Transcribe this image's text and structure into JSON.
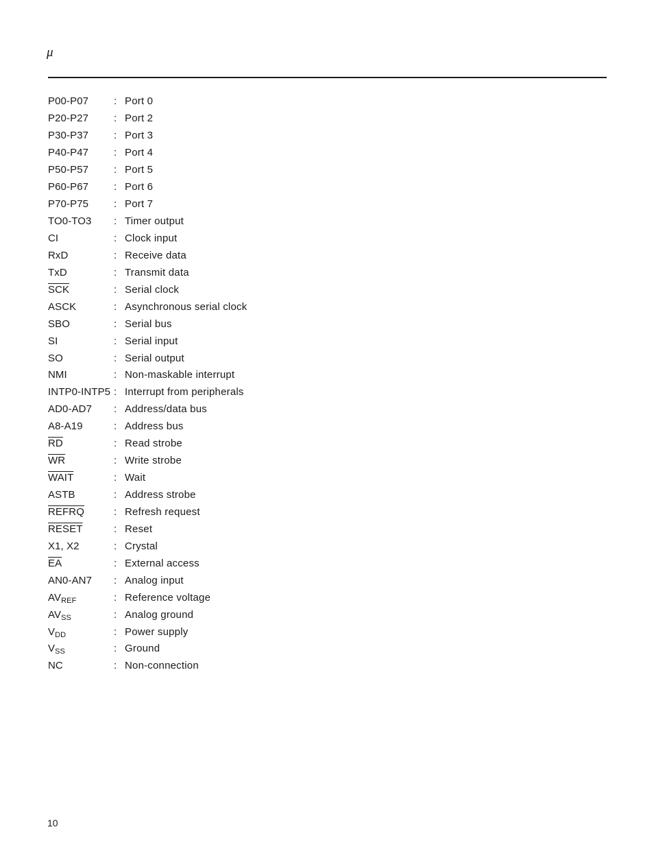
{
  "header": {
    "symbol": "μ"
  },
  "pins": [
    {
      "name": "P00-P07",
      "sub": "",
      "overbar": false,
      "desc": "Port 0"
    },
    {
      "name": "P20-P27",
      "sub": "",
      "overbar": false,
      "desc": "Port 2"
    },
    {
      "name": "P30-P37",
      "sub": "",
      "overbar": false,
      "desc": "Port 3"
    },
    {
      "name": "P40-P47",
      "sub": "",
      "overbar": false,
      "desc": "Port 4"
    },
    {
      "name": "P50-P57",
      "sub": "",
      "overbar": false,
      "desc": "Port 5"
    },
    {
      "name": "P60-P67",
      "sub": "",
      "overbar": false,
      "desc": "Port 6"
    },
    {
      "name": "P70-P75",
      "sub": "",
      "overbar": false,
      "desc": "Port 7"
    },
    {
      "name": "TO0-TO3",
      "sub": "",
      "overbar": false,
      "desc": "Timer output"
    },
    {
      "name": "CI",
      "sub": "",
      "overbar": false,
      "desc": "Clock input"
    },
    {
      "name": "RxD",
      "sub": "",
      "overbar": false,
      "desc": "Receive data"
    },
    {
      "name": "TxD",
      "sub": "",
      "overbar": false,
      "desc": "Transmit data"
    },
    {
      "name": "SCK",
      "sub": "",
      "overbar": true,
      "desc": "Serial clock"
    },
    {
      "name": "ASCK",
      "sub": "",
      "overbar": false,
      "desc": "Asynchronous serial clock"
    },
    {
      "name": "SBO",
      "sub": "",
      "overbar": false,
      "desc": "Serial bus"
    },
    {
      "name": "SI",
      "sub": "",
      "overbar": false,
      "desc": "Serial input"
    },
    {
      "name": "SO",
      "sub": "",
      "overbar": false,
      "desc": "Serial output"
    },
    {
      "name": "NMI",
      "sub": "",
      "overbar": false,
      "desc": "Non-maskable interrupt"
    },
    {
      "name": "INTP0-INTP5",
      "sub": "",
      "overbar": false,
      "desc": "Interrupt from peripherals"
    },
    {
      "name": "AD0-AD7",
      "sub": "",
      "overbar": false,
      "desc": "Address/data bus"
    },
    {
      "name": "A8-A19",
      "sub": "",
      "overbar": false,
      "desc": "Address bus"
    },
    {
      "name": "RD",
      "sub": "",
      "overbar": true,
      "desc": "Read strobe"
    },
    {
      "name": "WR",
      "sub": "",
      "overbar": true,
      "desc": "Write strobe"
    },
    {
      "name": "WAIT",
      "sub": "",
      "overbar": true,
      "desc": "Wait"
    },
    {
      "name": "ASTB",
      "sub": "",
      "overbar": false,
      "desc": "Address strobe"
    },
    {
      "name": "REFRQ",
      "sub": "",
      "overbar": true,
      "desc": "Refresh request"
    },
    {
      "name": "RESET",
      "sub": "",
      "overbar": true,
      "desc": "Reset"
    },
    {
      "name": "X1, X2",
      "sub": "",
      "overbar": false,
      "desc": "Crystal"
    },
    {
      "name": "EA",
      "sub": "",
      "overbar": true,
      "desc": "External access"
    },
    {
      "name": "AN0-AN7",
      "sub": "",
      "overbar": false,
      "desc": "Analog input"
    },
    {
      "name": "AV",
      "sub": "REF",
      "overbar": false,
      "desc": "Reference voltage"
    },
    {
      "name": "AV",
      "sub": "SS",
      "overbar": false,
      "desc": "Analog ground"
    },
    {
      "name": "V",
      "sub": "DD",
      "overbar": false,
      "desc": "Power supply"
    },
    {
      "name": "V",
      "sub": "SS",
      "overbar": false,
      "desc": "Ground"
    },
    {
      "name": "NC",
      "sub": "",
      "overbar": false,
      "desc": "Non-connection"
    }
  ],
  "separator": ":",
  "footer": {
    "page_number": "10"
  }
}
